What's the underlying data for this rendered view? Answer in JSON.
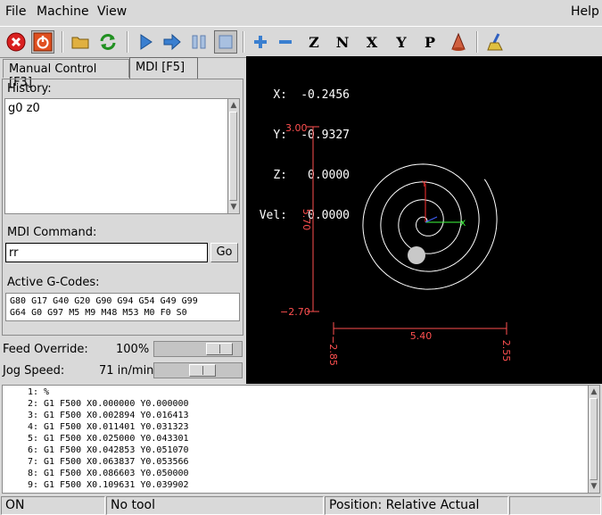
{
  "menu": {
    "file": "File",
    "machine": "Machine",
    "view": "View",
    "help": "Help"
  },
  "toolbar": {
    "icons": [
      "estop-icon",
      "power-icon",
      "open-file-icon",
      "reload-icon",
      "run-icon",
      "step-icon",
      "pause-icon",
      "stop-icon",
      "zoom-in-icon",
      "zoom-out-icon",
      "view-z-icon",
      "view-z2-icon",
      "view-x-icon",
      "view-y-icon",
      "view-p-icon",
      "rotate-view-icon",
      "clear-plot-icon"
    ],
    "axis_z": "Z",
    "axis_z2": "N",
    "axis_x": "X",
    "axis_y": "Y",
    "axis_p": "P"
  },
  "tabs": {
    "manual": "Manual Control [F3]",
    "mdi": "MDI [F5]"
  },
  "mdi": {
    "history_label": "History:",
    "history": [
      "g0 z0"
    ],
    "command_label": "MDI Command:",
    "command_value": "rr",
    "go_label": "Go",
    "gcodes_label": "Active G-Codes:",
    "gcodes_line1": "G80 G17 G40 G20 G90 G94 G54 G49 G99",
    "gcodes_line2": "G64 G0 G97 M5 M9 M48 M53 M0 F0 S0"
  },
  "overrides": {
    "feed_label": "Feed Override:",
    "feed_value": "100%",
    "feed_level": 0.85,
    "jog_label": "Jog Speed:",
    "jog_value": "71 in/min",
    "jog_level": 0.57
  },
  "dro": {
    "x_label": "X:",
    "x_value": "-0.2456",
    "y_label": "Y:",
    "y_value": "-0.9327",
    "z_label": "Z:",
    "z_value": "0.0000",
    "vel_label": "Vel:",
    "vel_value": "0.0000"
  },
  "extents": {
    "y_top": "3.00",
    "y_bottom": "−2.70",
    "y_size": "5.70",
    "x_left": "−2.85",
    "x_right": "2.55",
    "x_size": "5.40",
    "axis_y": "Y",
    "axis_x": "X"
  },
  "gcode": [
    {
      "n": "1:",
      "text": "%"
    },
    {
      "n": "2:",
      "text": "G1 F500 X0.000000 Y0.000000"
    },
    {
      "n": "3:",
      "text": "G1 F500 X0.002894 Y0.016413"
    },
    {
      "n": "4:",
      "text": "G1 F500 X0.011401 Y0.031323"
    },
    {
      "n": "5:",
      "text": "G1 F500 X0.025000 Y0.043301"
    },
    {
      "n": "6:",
      "text": "G1 F500 X0.042853 Y0.051070"
    },
    {
      "n": "7:",
      "text": "G1 F500 X0.063837 Y0.053566"
    },
    {
      "n": "8:",
      "text": "G1 F500 X0.086603 Y0.050000"
    },
    {
      "n": "9:",
      "text": "G1 F500 X0.109631 Y0.039902"
    }
  ],
  "status": {
    "state": "ON",
    "tool": "No tool",
    "position": "Position: Relative Actual"
  },
  "colors": {
    "extents": "#ff5050",
    "path": "#ffffff",
    "axis_x": "#40ff40",
    "axis_y": "#ff3030",
    "tool": "#c8c8c8"
  }
}
